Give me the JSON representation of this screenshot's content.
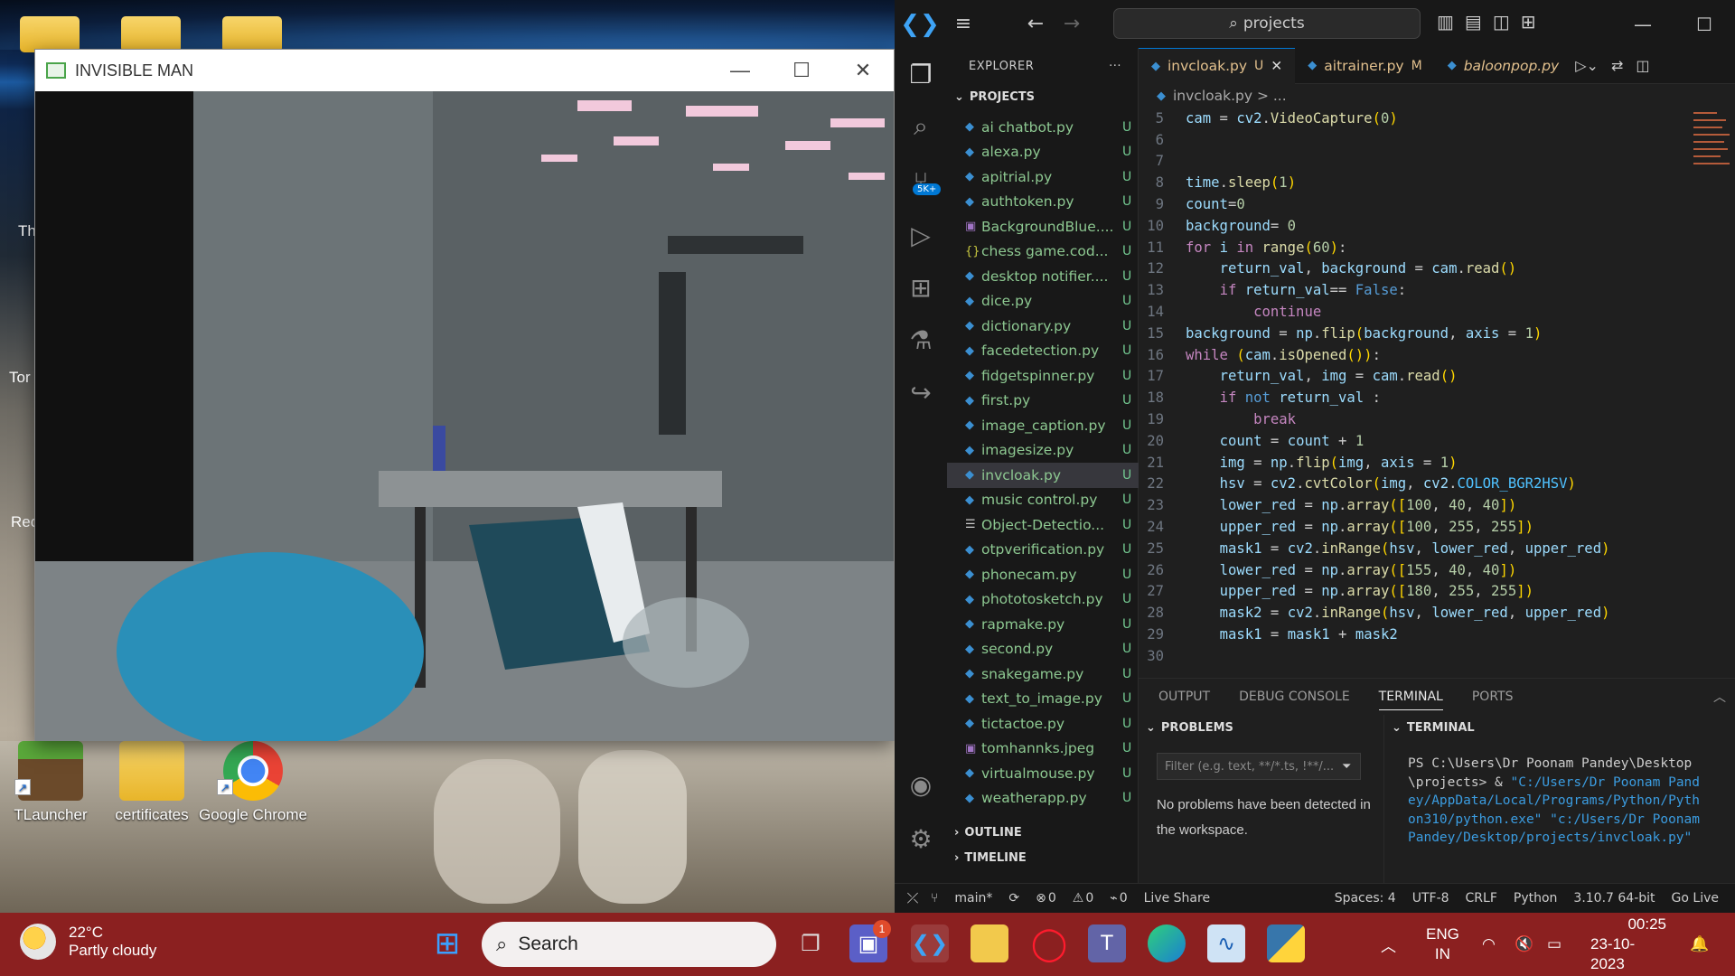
{
  "desktop": {
    "icons": [
      {
        "label": "TLauncher"
      },
      {
        "label": "certificates"
      },
      {
        "label": "Google Chrome"
      }
    ],
    "partial_labels": [
      "Th",
      "Tor",
      "Rec"
    ]
  },
  "python_window": {
    "title": "INVISIBLE MAN",
    "minimize": "—",
    "maximize": "☐",
    "close": "✕"
  },
  "vscode": {
    "title_search": "projects",
    "explorer_label": "EXPLORER",
    "explorer_more": "···",
    "section_projects": "PROJECTS",
    "section_outline": "OUTLINE",
    "section_timeline": "TIMELINE",
    "scm_badge": "5K+",
    "files": [
      {
        "name": "ai chatbot.py",
        "status": "U",
        "icon": "python-icon"
      },
      {
        "name": "alexa.py",
        "status": "U",
        "icon": "python-icon"
      },
      {
        "name": "apitrial.py",
        "status": "U",
        "icon": "python-icon"
      },
      {
        "name": "authtoken.py",
        "status": "U",
        "icon": "python-icon"
      },
      {
        "name": "BackgroundBlue....",
        "status": "U",
        "icon": "image-icon"
      },
      {
        "name": "chess game.cod...",
        "status": "U",
        "icon": "json-icon"
      },
      {
        "name": "desktop notifier....",
        "status": "U",
        "icon": "python-icon"
      },
      {
        "name": "dice.py",
        "status": "U",
        "icon": "python-icon"
      },
      {
        "name": "dictionary.py",
        "status": "U",
        "icon": "python-icon"
      },
      {
        "name": "facedetection.py",
        "status": "U",
        "icon": "python-icon"
      },
      {
        "name": "fidgetspinner.py",
        "status": "U",
        "icon": "python-icon"
      },
      {
        "name": "first.py",
        "status": "U",
        "icon": "python-icon"
      },
      {
        "name": "image_caption.py",
        "status": "U",
        "icon": "python-icon"
      },
      {
        "name": "imagesize.py",
        "status": "U",
        "icon": "python-icon"
      },
      {
        "name": "invcloak.py",
        "status": "U",
        "icon": "python-icon",
        "active": true
      },
      {
        "name": "music control.py",
        "status": "U",
        "icon": "python-icon"
      },
      {
        "name": "Object-Detectio...",
        "status": "U",
        "icon": "text-file-icon"
      },
      {
        "name": "otpverification.py",
        "status": "U",
        "icon": "python-icon"
      },
      {
        "name": "phonecam.py",
        "status": "U",
        "icon": "python-icon"
      },
      {
        "name": "phototosketch.py",
        "status": "U",
        "icon": "python-icon"
      },
      {
        "name": "rapmake.py",
        "status": "U",
        "icon": "python-icon"
      },
      {
        "name": "second.py",
        "status": "U",
        "icon": "python-icon"
      },
      {
        "name": "snakegame.py",
        "status": "U",
        "icon": "python-icon"
      },
      {
        "name": "text_to_image.py",
        "status": "U",
        "icon": "python-icon"
      },
      {
        "name": "tictactoe.py",
        "status": "U",
        "icon": "python-icon"
      },
      {
        "name": "tomhannks.jpeg",
        "status": "U",
        "icon": "image-icon"
      },
      {
        "name": "virtualmouse.py",
        "status": "U",
        "icon": "python-icon"
      },
      {
        "name": "weatherapp.py",
        "status": "U",
        "icon": "python-icon"
      }
    ],
    "tabs": [
      {
        "name": "invcloak.py",
        "status": "U",
        "active": true
      },
      {
        "name": "aitrainer.py",
        "status": "M"
      },
      {
        "name": "baloonpop.py",
        "status": ""
      }
    ],
    "breadcrumb": "invcloak.py > ...",
    "code_lines": [
      {
        "n": "5",
        "html": "<span class=\"v\">cam</span> = <span class=\"v\">cv2</span>.<span class=\"f\">VideoCapture</span><span class=\"p\">(</span><span class=\"n\">0</span><span class=\"p\">)</span>"
      },
      {
        "n": "6",
        "html": ""
      },
      {
        "n": "7",
        "html": ""
      },
      {
        "n": "8",
        "html": "<span class=\"v\">time</span>.<span class=\"f\">sleep</span><span class=\"p\">(</span><span class=\"n\">1</span><span class=\"p\">)</span>"
      },
      {
        "n": "9",
        "html": "<span class=\"v\">count</span>=<span class=\"n\">0</span>"
      },
      {
        "n": "10",
        "html": "<span class=\"v\">background</span>= <span class=\"n\">0</span>"
      },
      {
        "n": "11",
        "html": "<span class=\"k\">for</span> <span class=\"v\">i</span> <span class=\"k\">in</span> <span class=\"f\">range</span><span class=\"p\">(</span><span class=\"n\">60</span><span class=\"p\">)</span>:"
      },
      {
        "n": "12",
        "html": "    <span class=\"v\">return_val</span>, <span class=\"v\">background</span> = <span class=\"v\">cam</span>.<span class=\"f\">read</span><span class=\"p\">()</span>"
      },
      {
        "n": "13",
        "html": "    <span class=\"k\">if</span> <span class=\"v\">return_val</span>== <span class=\"kw\">False</span>:"
      },
      {
        "n": "14",
        "html": "        <span class=\"k\">continue</span>"
      },
      {
        "n": "15",
        "html": "<span class=\"v\">background</span> = <span class=\"v\">np</span>.<span class=\"f\">flip</span><span class=\"p\">(</span><span class=\"v\">background</span>, <span class=\"v\">axis</span> = <span class=\"n\">1</span><span class=\"p\">)</span>"
      },
      {
        "n": "16",
        "html": "<span class=\"k\">while</span> <span class=\"p\">(</span><span class=\"v\">cam</span>.<span class=\"f\">isOpened</span><span class=\"p\">())</span>:"
      },
      {
        "n": "17",
        "html": "    <span class=\"v\">return_val</span>, <span class=\"v\">img</span> = <span class=\"v\">cam</span>.<span class=\"f\">read</span><span class=\"p\">()</span>"
      },
      {
        "n": "18",
        "html": "    <span class=\"k\">if</span> <span class=\"kw\">not</span> <span class=\"v\">return_val</span> :"
      },
      {
        "n": "19",
        "html": "        <span class=\"k\">break</span>"
      },
      {
        "n": "20",
        "html": "    <span class=\"v\">count</span> = <span class=\"v\">count</span> + <span class=\"n\">1</span>"
      },
      {
        "n": "21",
        "html": "    <span class=\"v\">img</span> = <span class=\"v\">np</span>.<span class=\"f\">flip</span><span class=\"p\">(</span><span class=\"v\">img</span>, <span class=\"v\">axis</span> = <span class=\"n\">1</span><span class=\"p\">)</span>"
      },
      {
        "n": "22",
        "html": "    <span class=\"v\">hsv</span> = <span class=\"v\">cv2</span>.<span class=\"f\">cvtColor</span><span class=\"p\">(</span><span class=\"v\">img</span>, <span class=\"v\">cv2</span>.<span class=\"b\">COLOR_BGR2HSV</span><span class=\"p\">)</span>"
      },
      {
        "n": "23",
        "html": "    <span class=\"v\">lower_red</span> = <span class=\"v\">np</span>.<span class=\"f\">array</span><span class=\"p\">([</span><span class=\"n\">100</span>, <span class=\"n\">40</span>, <span class=\"n\">40</span><span class=\"p\">])</span>"
      },
      {
        "n": "24",
        "html": "    <span class=\"v\">upper_red</span> = <span class=\"v\">np</span>.<span class=\"f\">array</span><span class=\"p\">([</span><span class=\"n\">100</span>, <span class=\"n\">255</span>, <span class=\"n\">255</span><span class=\"p\">])</span>"
      },
      {
        "n": "25",
        "html": "    <span class=\"v\">mask1</span> = <span class=\"v\">cv2</span>.<span class=\"f\">inRange</span><span class=\"p\">(</span><span class=\"v\">hsv</span>, <span class=\"v\">lower_red</span>, <span class=\"v\">upper_red</span><span class=\"p\">)</span>"
      },
      {
        "n": "26",
        "html": "    <span class=\"v\">lower_red</span> = <span class=\"v\">np</span>.<span class=\"f\">array</span><span class=\"p\">([</span><span class=\"n\">155</span>, <span class=\"n\">40</span>, <span class=\"n\">40</span><span class=\"p\">])</span>"
      },
      {
        "n": "27",
        "html": "    <span class=\"v\">upper_red</span> = <span class=\"v\">np</span>.<span class=\"f\">array</span><span class=\"p\">([</span><span class=\"n\">180</span>, <span class=\"n\">255</span>, <span class=\"n\">255</span><span class=\"p\">])</span>"
      },
      {
        "n": "28",
        "html": "    <span class=\"v\">mask2</span> = <span class=\"v\">cv2</span>.<span class=\"f\">inRange</span><span class=\"p\">(</span><span class=\"v\">hsv</span>, <span class=\"v\">lower_red</span>, <span class=\"v\">upper_red</span><span class=\"p\">)</span>"
      },
      {
        "n": "29",
        "html": "    <span class=\"v\">mask1</span> = <span class=\"v\">mask1</span> + <span class=\"v\">mask2</span>"
      },
      {
        "n": "30",
        "html": ""
      }
    ],
    "panel": {
      "tabs": [
        "OUTPUT",
        "DEBUG CONSOLE",
        "TERMINAL",
        "PORTS"
      ],
      "active_tab": "TERMINAL",
      "problems_title": "PROBLEMS",
      "filter_placeholder": "Filter (e.g. text, **/*.ts, !**/...",
      "no_problems": "No problems have been detected in the workspace.",
      "terminal_title": "TERMINAL",
      "terminal_prompt": "PS C:\\Users\\Dr Poonam Pandey\\Desktop\\projects> & ",
      "terminal_cmd": "\"C:/Users/Dr Poonam Pandey/AppData/Local/Programs/Python/Python310/python.exe\" \"c:/Users/Dr Poonam Pandey/Desktop/projects/invcloak.py\""
    },
    "status": {
      "branch": "main*",
      "errors": "0",
      "warnings": "0",
      "ports": "0",
      "live_share": "Live Share",
      "spaces": "Spaces: 4",
      "encoding": "UTF-8",
      "eol": "CRLF",
      "language": "Python",
      "interpreter": "3.10.7 64-bit",
      "go_live": "Go Live"
    }
  },
  "taskbar": {
    "temperature": "22°C",
    "weather": "Partly cloudy",
    "search_label": "Search",
    "teams_badge": "1",
    "language": "ENG",
    "region": "IN",
    "time": "00:25",
    "date": "23-10-2023"
  },
  "colors": {
    "taskbar": "#8b2020",
    "vscode_bg": "#1f1f1f",
    "accent": "#0078d4"
  }
}
